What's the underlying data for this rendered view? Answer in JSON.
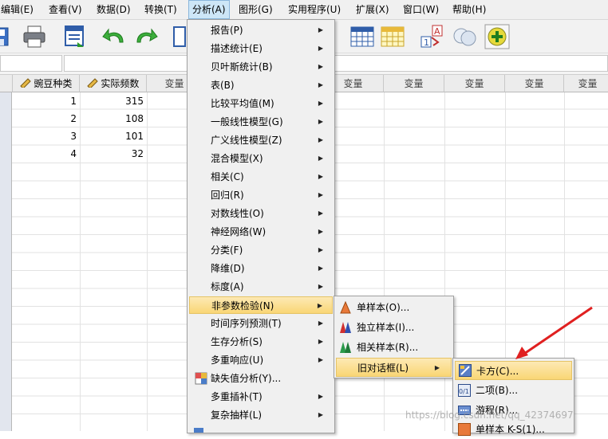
{
  "menubar": {
    "items": [
      "编辑(E)",
      "查看(V)",
      "数据(D)",
      "转换(T)",
      "分析(A)",
      "图形(G)",
      "实用程序(U)",
      "扩展(X)",
      "窗口(W)",
      "帮助(H)"
    ],
    "active": "分析(A)"
  },
  "grid": {
    "columns": [
      {
        "name": "豌豆种类",
        "type": "nominal"
      },
      {
        "name": "实际频数",
        "type": "scale"
      }
    ],
    "empty_column_label": "变量",
    "rows": [
      [
        "1",
        "315"
      ],
      [
        "2",
        "108"
      ],
      [
        "3",
        "101"
      ],
      [
        "4",
        "32"
      ]
    ]
  },
  "analyze_menu": {
    "items": [
      {
        "label": "报告(P)",
        "submenu": true
      },
      {
        "label": "描述统计(E)",
        "submenu": true
      },
      {
        "label": "贝叶斯统计(B)",
        "submenu": true
      },
      {
        "label": "表(B)",
        "submenu": true
      },
      {
        "label": "比较平均值(M)",
        "submenu": true
      },
      {
        "label": "一般线性模型(G)",
        "submenu": true
      },
      {
        "label": "广义线性模型(Z)",
        "submenu": true
      },
      {
        "label": "混合模型(X)",
        "submenu": true
      },
      {
        "label": "相关(C)",
        "submenu": true
      },
      {
        "label": "回归(R)",
        "submenu": true
      },
      {
        "label": "对数线性(O)",
        "submenu": true
      },
      {
        "label": "神经网络(W)",
        "submenu": true
      },
      {
        "label": "分类(F)",
        "submenu": true
      },
      {
        "label": "降维(D)",
        "submenu": true
      },
      {
        "label": "标度(A)",
        "submenu": true
      },
      {
        "label": "非参数检验(N)",
        "submenu": true,
        "highlighted": true
      },
      {
        "label": "时间序列预测(T)",
        "submenu": true
      },
      {
        "label": "生存分析(S)",
        "submenu": true
      },
      {
        "label": "多重响应(U)",
        "submenu": true
      },
      {
        "label": "缺失值分析(Y)...",
        "submenu": false,
        "icon": "missing-value-icon"
      },
      {
        "label": "多重插补(T)",
        "submenu": true
      },
      {
        "label": "复杂抽样(L)",
        "submenu": true
      }
    ]
  },
  "nonparametric_menu": {
    "items": [
      {
        "label": "单样本(O)...",
        "icon": "one-sample-icon"
      },
      {
        "label": "独立样本(I)...",
        "icon": "independent-samples-icon"
      },
      {
        "label": "相关样本(R)...",
        "icon": "related-samples-icon"
      },
      {
        "label": "旧对话框(L)",
        "submenu": true,
        "highlighted": true
      }
    ]
  },
  "legacy_dialogs_menu": {
    "items": [
      {
        "label": "卡方(C)...",
        "icon": "chi-square-icon",
        "highlighted": true
      },
      {
        "label": "二项(B)...",
        "icon": "binomial-icon"
      },
      {
        "label": "游程(R)...",
        "icon": "runs-icon"
      },
      {
        "label": "单样本 K-S(1)...",
        "icon": "one-sample-ks-icon"
      }
    ]
  },
  "annotation": {
    "arrow_color": "#e02020"
  },
  "watermark": "https://blog.csdn.net/qq_42374697",
  "colors": {
    "menu_highlight": "#f9d675",
    "menubar_active": "#cde6f7"
  }
}
